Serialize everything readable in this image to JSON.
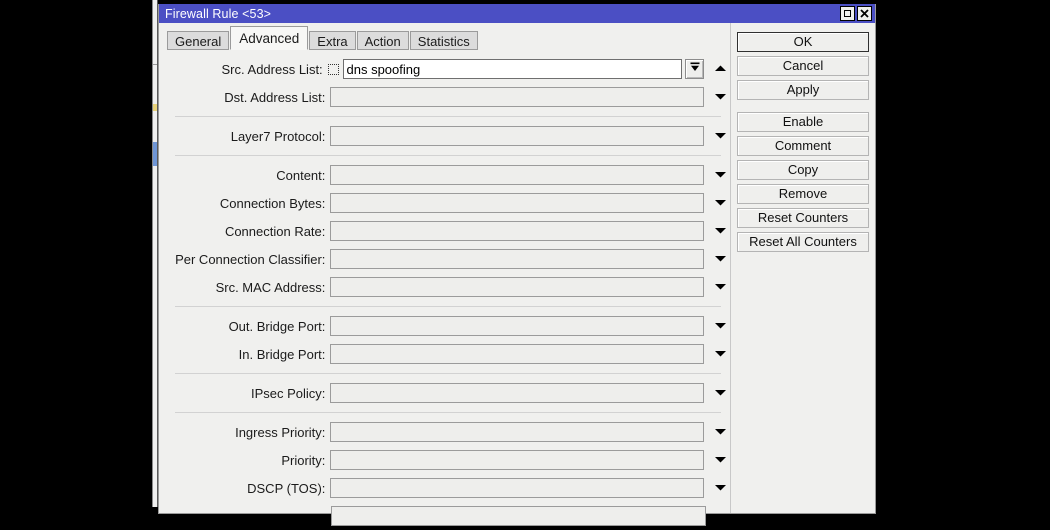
{
  "window": {
    "title": "Firewall Rule <53>",
    "title_buttons": [
      {
        "name": "maximize-button",
        "icon": "square-icon"
      },
      {
        "name": "close-button",
        "icon": "close-x-icon"
      }
    ]
  },
  "tabs": [
    {
      "label": "General",
      "active": false
    },
    {
      "label": "Advanced",
      "active": true
    },
    {
      "label": "Extra",
      "active": false
    },
    {
      "label": "Action",
      "active": false
    },
    {
      "label": "Statistics",
      "active": false
    }
  ],
  "form": {
    "groups": [
      {
        "rows": [
          {
            "label": "Src. Address List:",
            "value": "dns spoofing",
            "active": true,
            "negate": true,
            "dropdown": "boxed-down-arrow",
            "extra": "up-triangle"
          },
          {
            "label": "Dst. Address List:",
            "value": "",
            "active": false,
            "negate": false,
            "dropdown": "triangle"
          }
        ]
      },
      {
        "rows": [
          {
            "label": "Layer7 Protocol:",
            "value": "",
            "active": false,
            "negate": false,
            "dropdown": "triangle"
          }
        ]
      },
      {
        "rows": [
          {
            "label": "Content:",
            "value": "",
            "active": false,
            "negate": false,
            "dropdown": "triangle"
          },
          {
            "label": "Connection Bytes:",
            "value": "",
            "active": false,
            "negate": false,
            "dropdown": "triangle"
          },
          {
            "label": "Connection Rate:",
            "value": "",
            "active": false,
            "negate": false,
            "dropdown": "triangle"
          },
          {
            "label": "Per Connection Classifier:",
            "value": "",
            "active": false,
            "negate": false,
            "dropdown": "triangle"
          },
          {
            "label": "Src. MAC Address:",
            "value": "",
            "active": false,
            "negate": false,
            "dropdown": "triangle"
          }
        ]
      },
      {
        "rows": [
          {
            "label": "Out. Bridge Port:",
            "value": "",
            "active": false,
            "negate": false,
            "dropdown": "triangle"
          },
          {
            "label": "In. Bridge Port:",
            "value": "",
            "active": false,
            "negate": false,
            "dropdown": "triangle"
          }
        ]
      },
      {
        "rows": [
          {
            "label": "IPsec Policy:",
            "value": "",
            "active": false,
            "negate": false,
            "dropdown": "triangle"
          }
        ]
      },
      {
        "rows": [
          {
            "label": "Ingress Priority:",
            "value": "",
            "active": false,
            "negate": false,
            "dropdown": "triangle"
          },
          {
            "label": "Priority:",
            "value": "",
            "active": false,
            "negate": false,
            "dropdown": "triangle"
          },
          {
            "label": "DSCP (TOS):",
            "value": "",
            "active": false,
            "negate": false,
            "dropdown": "triangle"
          },
          {
            "label": "",
            "value": "",
            "active": false,
            "negate": false,
            "dropdown": "none"
          }
        ]
      }
    ]
  },
  "buttons": [
    {
      "label": "OK",
      "primary": true
    },
    {
      "label": "Cancel",
      "primary": false
    },
    {
      "label": "Apply",
      "primary": false
    },
    {
      "label": "__GAP__",
      "primary": false
    },
    {
      "label": "Enable",
      "primary": false
    },
    {
      "label": "Comment",
      "primary": false
    },
    {
      "label": "Copy",
      "primary": false
    },
    {
      "label": "Remove",
      "primary": false
    },
    {
      "label": "Reset Counters",
      "primary": false
    },
    {
      "label": "Reset All Counters",
      "primary": false
    }
  ],
  "colors": {
    "titlebar": "#4b4fc4",
    "dialog_bg": "#f0f0ee",
    "field_disabled": "#eeeeec",
    "field_active": "#ffffff",
    "desktop": "#000000"
  }
}
